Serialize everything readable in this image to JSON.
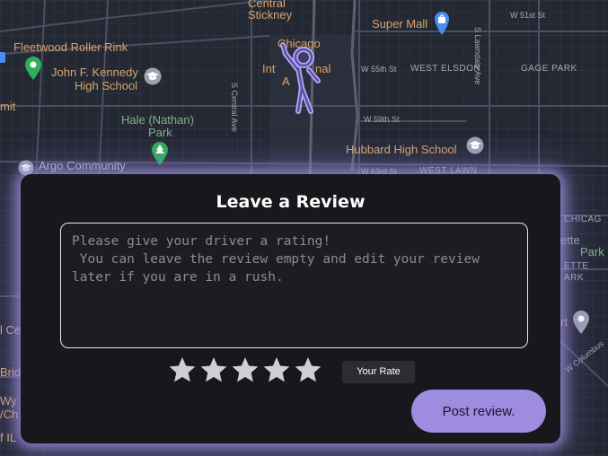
{
  "map": {
    "places": {
      "central_stickney_1": "Central",
      "central_stickney_2": "Stickney",
      "super_mall": "Super Mall",
      "fleetwood": "Fleetwood Roller Rink",
      "jfk_1": "John F. Kennedy",
      "jfk_2": "High School",
      "chicago_airport_1": "Chicago",
      "chicago_airport_2": "Int",
      "chicago_airport_3": "nal",
      "chicago_airport_4": "A",
      "w_55th": "W 55th St",
      "west_elsdon": "WEST ELSDON",
      "gage_park": "GAGE PARK",
      "w_51st": "W 51st St",
      "lawndale": "S Lawndale Ave",
      "summit": "mit",
      "hale_1": "Hale (Nathan)",
      "hale_2": "Park",
      "central_ave": "S Central Ave",
      "w_59th": "W 59th St",
      "hubbard": "Hubbard High School",
      "argo": "Argo Community",
      "w_63rd": "W 63rd St",
      "west_lawn": "WEST LAWN",
      "chicago_right": "CHICAG",
      "ette": "ette",
      "ette_park": "Park",
      "ette_caps": "ETTE",
      "ark": "ARK",
      "rt": "rt",
      "w_columbus": "W Columbus",
      "left_ce": "l Ce",
      "left_brid": "Brid",
      "left_wy": "Wy",
      "left_ch": "/Ch",
      "left_il": "f IL"
    }
  },
  "review": {
    "title": "Leave a Review",
    "placeholder": "Please give your driver a rating!\n You can leave the review empty and edit your review later if you are in a rush.",
    "value": "",
    "stars_total": 5,
    "rating": 0,
    "rate_tag": "Your Rate",
    "post_label": "Post review."
  },
  "colors": {
    "accent": "#9d8ce0",
    "glow": "#a596eb",
    "star": "#cfcfd3",
    "map_bg": "#242833"
  },
  "icons": [
    "school-icon",
    "shopping-bag-pin-icon",
    "park-pin-icon",
    "tree-pin-icon",
    "location-pin-icon",
    "star-icon",
    "waving-mascot-icon"
  ]
}
